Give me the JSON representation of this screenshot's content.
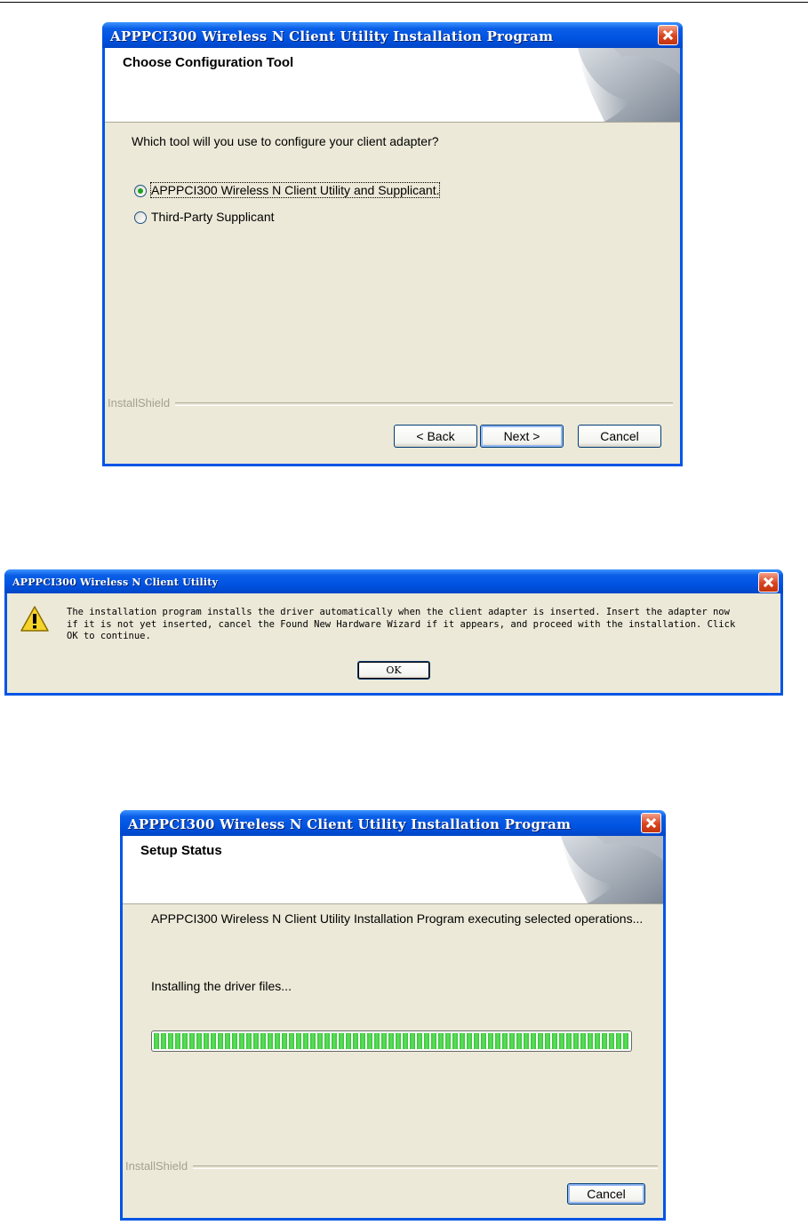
{
  "wizard1": {
    "title": "APPPCI300 Wireless N Client Utility Installation Program",
    "header": "Choose Configuration Tool",
    "question": "Which tool will you use to configure your client adapter?",
    "options": [
      {
        "label": "APPPCI300 Wireless N Client Utility and Supplicant.",
        "selected": true
      },
      {
        "label": "Third-Party Supplicant",
        "selected": false
      }
    ],
    "brand": "InstallShield",
    "buttons": {
      "back": "< Back",
      "next": "Next >",
      "cancel": "Cancel"
    }
  },
  "alert": {
    "title": "APPPCI300 Wireless N Client Utility",
    "lines": [
      "The installation program installs the driver automatically when the client adapter is inserted. Insert the adapter now",
      "if it is not yet inserted, cancel the Found New Hardware Wizard if it appears, and proceed with the installation. Click",
      "OK to continue."
    ],
    "icon": "warning-icon",
    "ok": "OK"
  },
  "wizard2": {
    "title": "APPPCI300 Wireless N Client Utility Installation Program",
    "header": "Setup Status",
    "status": "APPPCI300 Wireless N Client Utility Installation Program executing selected operations...",
    "action": "Installing the driver files...",
    "progress_fraction": 1.0,
    "brand": "InstallShield",
    "cancel": "Cancel"
  },
  "colors": {
    "titlebar": "#0054e3",
    "dialog_bg": "#ece9d8",
    "progress": "#37c33a",
    "close": "#d9441f"
  }
}
